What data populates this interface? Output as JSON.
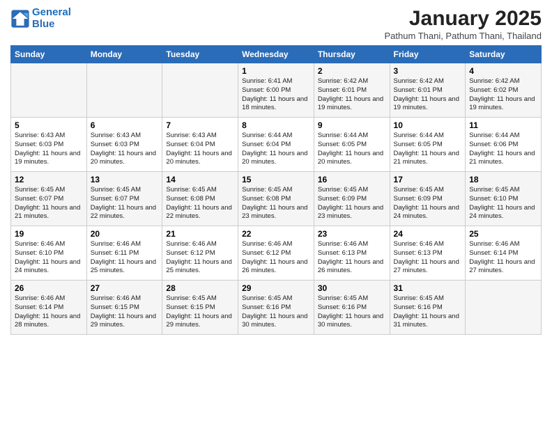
{
  "header": {
    "logo_line1": "General",
    "logo_line2": "Blue",
    "month": "January 2025",
    "location": "Pathum Thani, Pathum Thani, Thailand"
  },
  "days_of_week": [
    "Sunday",
    "Monday",
    "Tuesday",
    "Wednesday",
    "Thursday",
    "Friday",
    "Saturday"
  ],
  "weeks": [
    [
      {
        "day": "",
        "info": ""
      },
      {
        "day": "",
        "info": ""
      },
      {
        "day": "",
        "info": ""
      },
      {
        "day": "1",
        "info": "Sunrise: 6:41 AM\nSunset: 6:00 PM\nDaylight: 11 hours and 18 minutes."
      },
      {
        "day": "2",
        "info": "Sunrise: 6:42 AM\nSunset: 6:01 PM\nDaylight: 11 hours and 19 minutes."
      },
      {
        "day": "3",
        "info": "Sunrise: 6:42 AM\nSunset: 6:01 PM\nDaylight: 11 hours and 19 minutes."
      },
      {
        "day": "4",
        "info": "Sunrise: 6:42 AM\nSunset: 6:02 PM\nDaylight: 11 hours and 19 minutes."
      }
    ],
    [
      {
        "day": "5",
        "info": "Sunrise: 6:43 AM\nSunset: 6:03 PM\nDaylight: 11 hours and 19 minutes."
      },
      {
        "day": "6",
        "info": "Sunrise: 6:43 AM\nSunset: 6:03 PM\nDaylight: 11 hours and 20 minutes."
      },
      {
        "day": "7",
        "info": "Sunrise: 6:43 AM\nSunset: 6:04 PM\nDaylight: 11 hours and 20 minutes."
      },
      {
        "day": "8",
        "info": "Sunrise: 6:44 AM\nSunset: 6:04 PM\nDaylight: 11 hours and 20 minutes."
      },
      {
        "day": "9",
        "info": "Sunrise: 6:44 AM\nSunset: 6:05 PM\nDaylight: 11 hours and 20 minutes."
      },
      {
        "day": "10",
        "info": "Sunrise: 6:44 AM\nSunset: 6:05 PM\nDaylight: 11 hours and 21 minutes."
      },
      {
        "day": "11",
        "info": "Sunrise: 6:44 AM\nSunset: 6:06 PM\nDaylight: 11 hours and 21 minutes."
      }
    ],
    [
      {
        "day": "12",
        "info": "Sunrise: 6:45 AM\nSunset: 6:07 PM\nDaylight: 11 hours and 21 minutes."
      },
      {
        "day": "13",
        "info": "Sunrise: 6:45 AM\nSunset: 6:07 PM\nDaylight: 11 hours and 22 minutes."
      },
      {
        "day": "14",
        "info": "Sunrise: 6:45 AM\nSunset: 6:08 PM\nDaylight: 11 hours and 22 minutes."
      },
      {
        "day": "15",
        "info": "Sunrise: 6:45 AM\nSunset: 6:08 PM\nDaylight: 11 hours and 23 minutes."
      },
      {
        "day": "16",
        "info": "Sunrise: 6:45 AM\nSunset: 6:09 PM\nDaylight: 11 hours and 23 minutes."
      },
      {
        "day": "17",
        "info": "Sunrise: 6:45 AM\nSunset: 6:09 PM\nDaylight: 11 hours and 24 minutes."
      },
      {
        "day": "18",
        "info": "Sunrise: 6:45 AM\nSunset: 6:10 PM\nDaylight: 11 hours and 24 minutes."
      }
    ],
    [
      {
        "day": "19",
        "info": "Sunrise: 6:46 AM\nSunset: 6:10 PM\nDaylight: 11 hours and 24 minutes."
      },
      {
        "day": "20",
        "info": "Sunrise: 6:46 AM\nSunset: 6:11 PM\nDaylight: 11 hours and 25 minutes."
      },
      {
        "day": "21",
        "info": "Sunrise: 6:46 AM\nSunset: 6:12 PM\nDaylight: 11 hours and 25 minutes."
      },
      {
        "day": "22",
        "info": "Sunrise: 6:46 AM\nSunset: 6:12 PM\nDaylight: 11 hours and 26 minutes."
      },
      {
        "day": "23",
        "info": "Sunrise: 6:46 AM\nSunset: 6:13 PM\nDaylight: 11 hours and 26 minutes."
      },
      {
        "day": "24",
        "info": "Sunrise: 6:46 AM\nSunset: 6:13 PM\nDaylight: 11 hours and 27 minutes."
      },
      {
        "day": "25",
        "info": "Sunrise: 6:46 AM\nSunset: 6:14 PM\nDaylight: 11 hours and 27 minutes."
      }
    ],
    [
      {
        "day": "26",
        "info": "Sunrise: 6:46 AM\nSunset: 6:14 PM\nDaylight: 11 hours and 28 minutes."
      },
      {
        "day": "27",
        "info": "Sunrise: 6:46 AM\nSunset: 6:15 PM\nDaylight: 11 hours and 29 minutes."
      },
      {
        "day": "28",
        "info": "Sunrise: 6:45 AM\nSunset: 6:15 PM\nDaylight: 11 hours and 29 minutes."
      },
      {
        "day": "29",
        "info": "Sunrise: 6:45 AM\nSunset: 6:16 PM\nDaylight: 11 hours and 30 minutes."
      },
      {
        "day": "30",
        "info": "Sunrise: 6:45 AM\nSunset: 6:16 PM\nDaylight: 11 hours and 30 minutes."
      },
      {
        "day": "31",
        "info": "Sunrise: 6:45 AM\nSunset: 6:16 PM\nDaylight: 11 hours and 31 minutes."
      },
      {
        "day": "",
        "info": ""
      }
    ]
  ]
}
